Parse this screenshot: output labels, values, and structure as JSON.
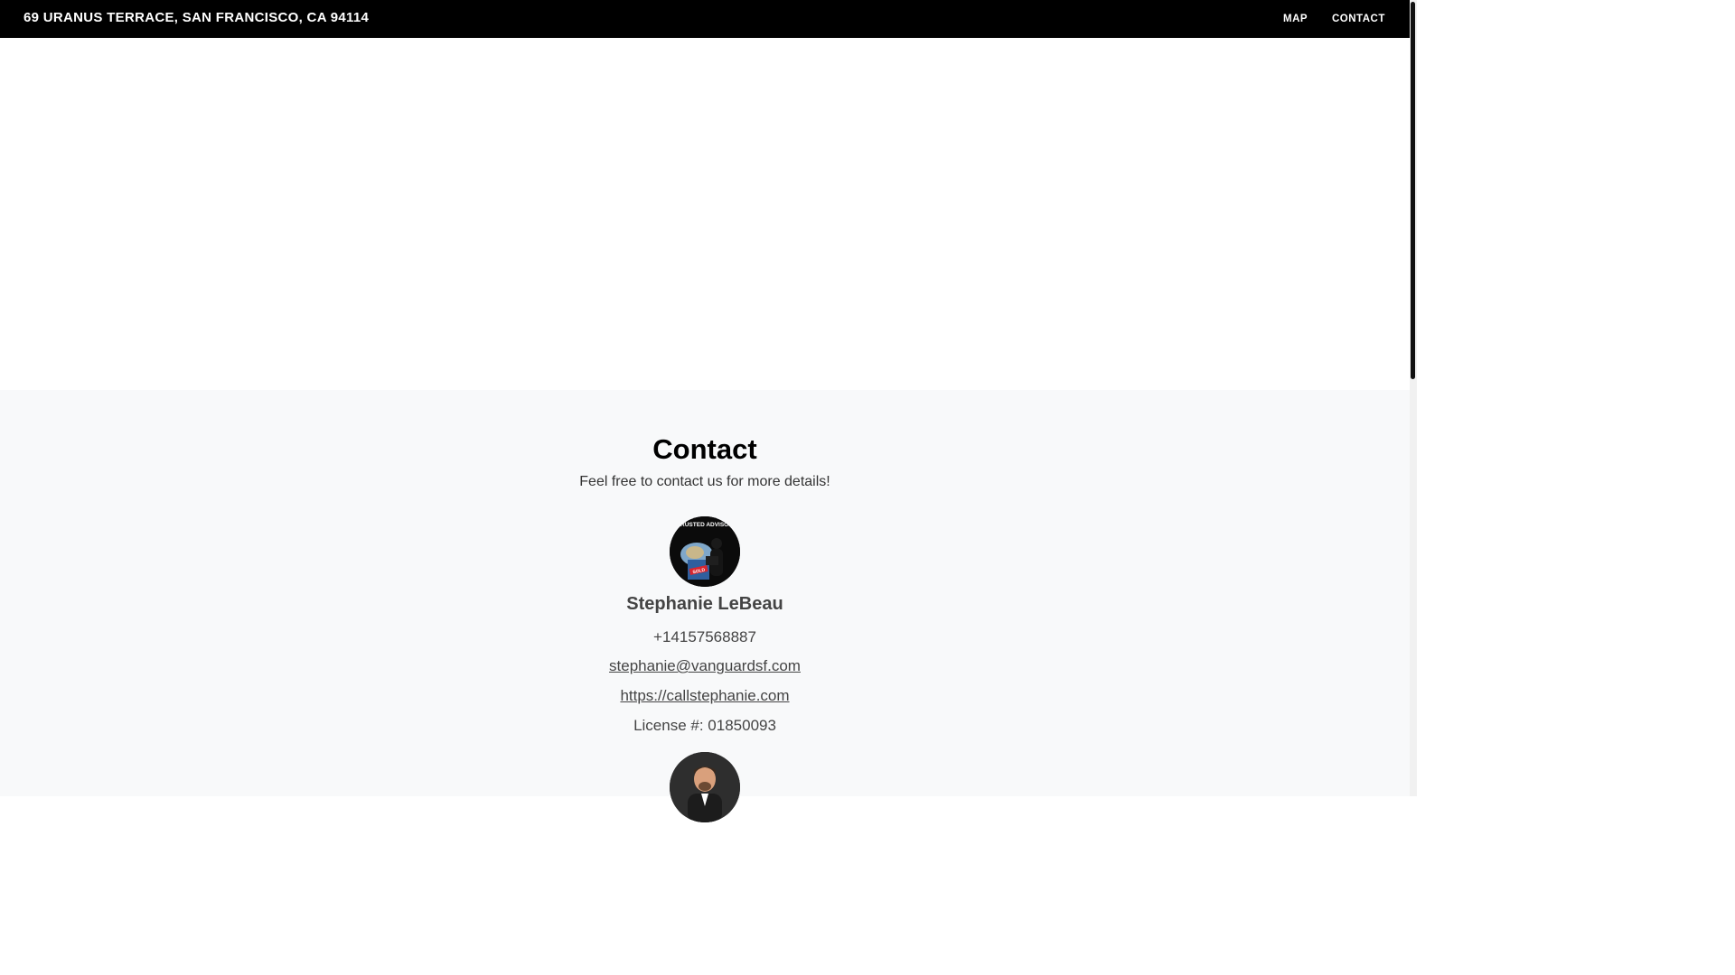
{
  "header": {
    "title": "69 URANUS TERRACE, SAN FRANCISCO, CA 94114",
    "nav": [
      {
        "label": "MAP"
      },
      {
        "label": "CONTACT"
      }
    ]
  },
  "contact": {
    "heading": "Contact",
    "subtitle": "Feel free to contact us for more details!",
    "agents": [
      {
        "name": "Stephanie LeBeau",
        "phone": "+14157568887",
        "email": "stephanie@vanguardsf.com",
        "website": "https://callstephanie.com",
        "license_label": "License #:",
        "license_number": "01850093",
        "avatar_banner": "TRUSTED ADVISOR",
        "avatar_sign": "SOLD"
      }
    ]
  },
  "colors": {
    "nav_bg": "#000000",
    "section_bg": "#f8f9fa",
    "text": "#444444"
  }
}
